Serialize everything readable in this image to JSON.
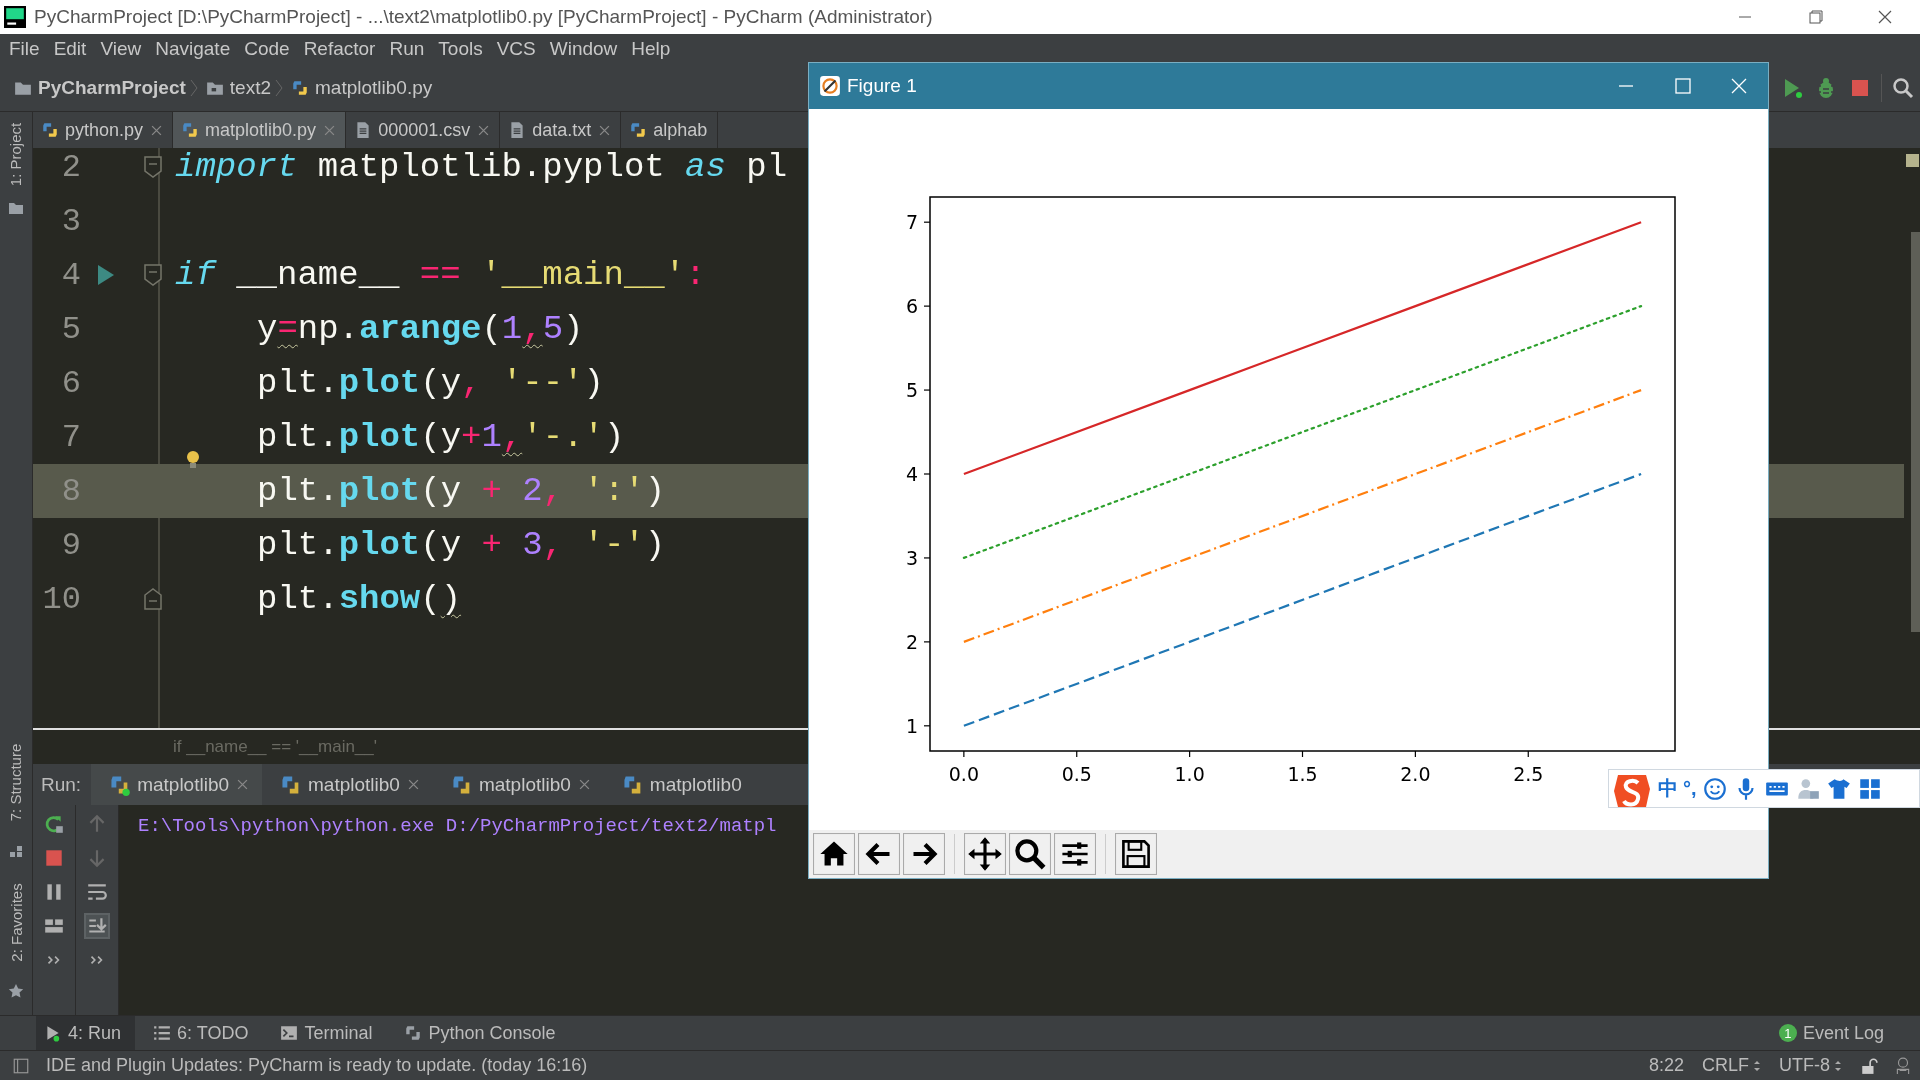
{
  "window": {
    "title": "PyCharmProject [D:\\PyCharmProject] - ...\\text2\\matplotlib0.py [PyCharmProject] - PyCharm (Administrator)"
  },
  "menu": [
    "File",
    "Edit",
    "View",
    "Navigate",
    "Code",
    "Refactor",
    "Run",
    "Tools",
    "VCS",
    "Window",
    "Help"
  ],
  "breadcrumb": [
    {
      "kind": "project",
      "label": "PyCharmProject"
    },
    {
      "kind": "folder",
      "label": "text2"
    },
    {
      "kind": "python",
      "label": "matplotlib0.py"
    }
  ],
  "editor_tabs": [
    {
      "kind": "python",
      "label": "python.py",
      "selected": false,
      "closable": true
    },
    {
      "kind": "python",
      "label": "matplotlib0.py",
      "selected": true,
      "closable": true
    },
    {
      "kind": "text",
      "label": "000001.csv",
      "selected": false,
      "closable": true
    },
    {
      "kind": "text",
      "label": "data.txt",
      "selected": false,
      "closable": true
    },
    {
      "kind": "python",
      "label": "alphab",
      "selected": false,
      "closable": false
    }
  ],
  "left_strip": {
    "top": [
      "1: Project"
    ],
    "bottom": [
      "7: Structure",
      "2: Favorites"
    ]
  },
  "code_lines": [
    {
      "number": "2",
      "current": false,
      "gutter": [
        {
          "kind": "fold_start"
        }
      ],
      "tokens": [
        {
          "kind": "keyword",
          "text": "import"
        },
        {
          "kind": "plain",
          "text": " matplotlib.pyplot "
        },
        {
          "kind": "keyword",
          "text": "as"
        },
        {
          "kind": "plain",
          "text": " pl"
        }
      ]
    },
    {
      "number": "3",
      "current": false
    },
    {
      "number": "4",
      "current": false,
      "gutter": [
        {
          "kind": "run"
        },
        {
          "kind": "fold_start"
        }
      ],
      "tokens": [
        {
          "kind": "keyword",
          "text": "if"
        },
        {
          "kind": "plain",
          "text": " __name__ "
        },
        {
          "kind": "op",
          "text": "== "
        },
        {
          "kind": "string",
          "text": "'__main__'"
        },
        {
          "kind": "op",
          "text": ":"
        }
      ],
      "children": [
        {
          "number": "5",
          "current": false,
          "tokens": [
            {
              "kind": "plain",
              "text": "y"
            },
            {
              "kind": "op",
              "text": "=",
              "warning": true
            },
            {
              "kind": "plain",
              "text": "np."
            },
            {
              "kind": "func",
              "text": "arange"
            },
            {
              "kind": "plain",
              "text": "("
            },
            {
              "kind": "number",
              "text": "1"
            },
            {
              "kind": "op",
              "text": ",",
              "warning": true
            },
            {
              "kind": "number",
              "text": "5"
            },
            {
              "kind": "plain",
              "text": ")"
            }
          ]
        },
        {
          "number": "6",
          "current": false,
          "tokens": [
            {
              "kind": "plain",
              "text": "plt."
            },
            {
              "kind": "func",
              "text": "plot"
            },
            {
              "kind": "plain",
              "text": "(y"
            },
            {
              "kind": "op",
              "text": ", "
            },
            {
              "kind": "string",
              "text": "'--'"
            },
            {
              "kind": "plain",
              "text": ")"
            }
          ]
        },
        {
          "number": "7",
          "current": false,
          "tokens": [
            {
              "kind": "plain",
              "text": "plt."
            },
            {
              "kind": "func",
              "text": "plot"
            },
            {
              "kind": "plain",
              "text": "(y"
            },
            {
              "kind": "op",
              "text": "+"
            },
            {
              "kind": "number",
              "text": "1"
            },
            {
              "kind": "op",
              "text": ",",
              "warning": true
            },
            {
              "kind": "string",
              "text": "'-.'"
            },
            {
              "kind": "plain",
              "text": ")"
            }
          ]
        },
        {
          "number": "8",
          "current": true,
          "gutter": [
            {
              "kind": "bulb"
            }
          ],
          "tokens": [
            {
              "kind": "plain",
              "text": "plt."
            },
            {
              "kind": "func",
              "text": "plot"
            },
            {
              "kind": "plain",
              "text": "(y"
            },
            {
              "kind": "op",
              "text": " + "
            },
            {
              "kind": "number",
              "text": "2"
            },
            {
              "kind": "op",
              "text": ", "
            },
            {
              "kind": "string",
              "text": "':'"
            },
            {
              "kind": "plain",
              "text": ")"
            }
          ]
        },
        {
          "number": "9",
          "current": false,
          "tokens": [
            {
              "kind": "plain",
              "text": "plt."
            },
            {
              "kind": "func",
              "text": "plot"
            },
            {
              "kind": "plain",
              "text": "(y"
            },
            {
              "kind": "op",
              "text": " + "
            },
            {
              "kind": "number",
              "text": "3"
            },
            {
              "kind": "op",
              "text": ", "
            },
            {
              "kind": "string",
              "text": "'-'"
            },
            {
              "kind": "plain",
              "text": ")"
            }
          ]
        },
        {
          "number": "10",
          "current": false,
          "gutter": [
            {
              "kind": "fold_end"
            }
          ],
          "tokens": [
            {
              "kind": "plain",
              "text": "plt."
            },
            {
              "kind": "func",
              "text": "show"
            },
            {
              "kind": "plain",
              "text": "("
            },
            {
              "kind": "plain",
              "text": ")",
              "warning": true
            }
          ]
        }
      ]
    }
  ],
  "editor_breadcrumb": "if __name__ == '__main__'",
  "run_panel": {
    "label": "Run:",
    "tabs": [
      {
        "label": "matplotlib0",
        "selected": true,
        "closable": true
      },
      {
        "label": "matplotlib0",
        "selected": false,
        "closable": true
      },
      {
        "label": "matplotlib0",
        "selected": false,
        "closable": true
      },
      {
        "label": "matplotlib0",
        "selected": false,
        "closable": false
      }
    ],
    "console": [
      "E:\\Tools\\python\\python.exe D:/PyCharmProject/text2/matpl"
    ]
  },
  "bottom_tabs": [
    {
      "kind": "run",
      "label": "4: Run",
      "selected": true
    },
    {
      "kind": "todo",
      "label": "6: TODO",
      "selected": false
    },
    {
      "kind": "terminal",
      "label": "Terminal",
      "selected": false
    },
    {
      "kind": "console",
      "label": "Python Console",
      "selected": false
    }
  ],
  "event_log": {
    "count": "1",
    "label": "Event Log"
  },
  "status_bar": {
    "message": "IDE and Plugin Updates: PyCharm is ready to update. (today 16:16)",
    "position": "8:22",
    "line_separator": "CRLF",
    "encoding": "UTF-8"
  },
  "figure": {
    "title": "Figure 1",
    "chart_data": {
      "type": "line",
      "x": [
        0,
        1,
        2,
        3
      ],
      "series": [
        {
          "color": "#1f77b4",
          "line_style": "dashed",
          "values": [
            1,
            2,
            3,
            4
          ]
        },
        {
          "color": "#ff7f0e",
          "line_style": "dashdot",
          "values": [
            2,
            3,
            4,
            5
          ]
        },
        {
          "color": "#2ca02c",
          "line_style": "dotted",
          "values": [
            3,
            4,
            5,
            6
          ]
        },
        {
          "color": "#d62728",
          "line_style": "solid",
          "values": [
            4,
            5,
            6,
            7
          ]
        }
      ],
      "xlim": [
        -0.15,
        3.15
      ],
      "ylim": [
        0.7,
        7.3
      ],
      "xticks": [
        {
          "value": 0,
          "label": "0.0"
        },
        {
          "value": 0.5,
          "label": "0.5"
        },
        {
          "value": 1,
          "label": "1.0"
        },
        {
          "value": 1.5,
          "label": "1.5"
        },
        {
          "value": 2,
          "label": "2.0"
        },
        {
          "value": 2.5,
          "label": "2.5"
        }
      ],
      "yticks": [
        1,
        2,
        3,
        4,
        5,
        6,
        7
      ]
    },
    "toolbar": [
      [
        {
          "kind": "home"
        },
        {
          "kind": "back"
        },
        {
          "kind": "forward"
        }
      ],
      [
        {
          "kind": "pan"
        },
        {
          "kind": "zoom"
        },
        {
          "kind": "configure"
        }
      ],
      [
        {
          "kind": "save"
        }
      ]
    ]
  },
  "ime_bar": [
    {
      "kind": "logo"
    },
    {
      "kind": "text",
      "text": "中"
    },
    {
      "kind": "text",
      "text": "°,"
    },
    {
      "kind": "smiley"
    },
    {
      "kind": "mic"
    },
    {
      "kind": "keyboard"
    },
    {
      "kind": "user"
    },
    {
      "kind": "shirt"
    },
    {
      "kind": "grid"
    }
  ]
}
